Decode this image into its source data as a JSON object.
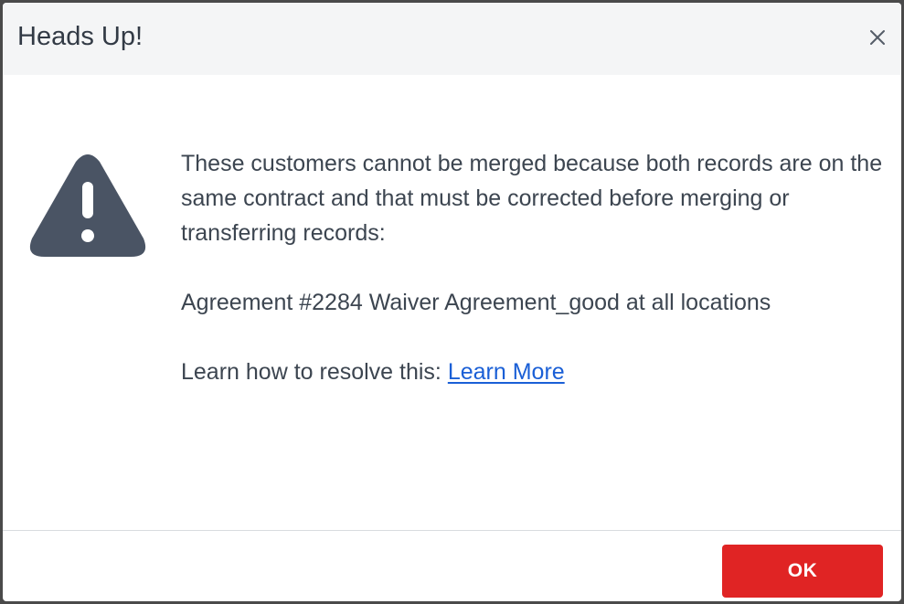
{
  "dialog": {
    "title": "Heads Up!",
    "close_icon": "close-icon",
    "message": {
      "line1": "These customers cannot be merged because both records are on the same contract and that must be corrected before merging or transferring records:",
      "agreement": "Agreement #2284 Waiver Agreement_good at all locations",
      "resolve_prefix": "Learn how to resolve this: ",
      "learn_more_label": "Learn More"
    },
    "icon": "warning-icon",
    "ok_label": "OK"
  },
  "colors": {
    "header_bg": "#f4f5f6",
    "text": "#3c4550",
    "icon": "#4a5464",
    "link": "#1a5fd6",
    "ok_button": "#e02424"
  }
}
